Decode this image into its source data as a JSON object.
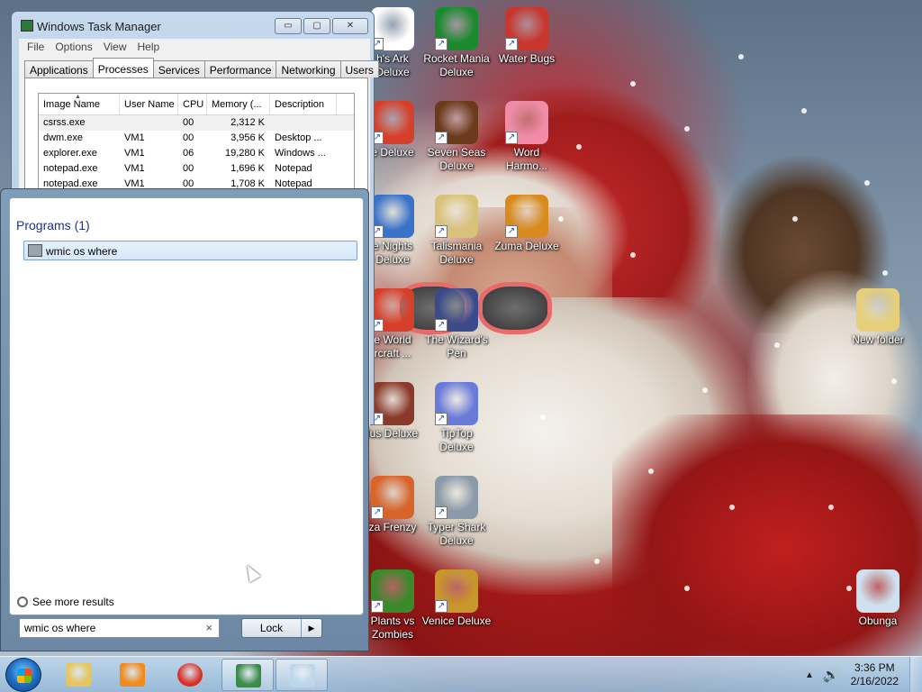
{
  "desktop": {
    "icons": [
      {
        "label": "h's Ark\nDeluxe",
        "color": "#ffffff"
      },
      {
        "label": "Rocket Mania\nDeluxe",
        "color": "#1b8a2e"
      },
      {
        "label": "Water Bugs",
        "color": "#c8362e"
      },
      {
        "label": "e Deluxe",
        "color": "#d6402a"
      },
      {
        "label": "Seven Seas\nDeluxe",
        "color": "#6b3a1a"
      },
      {
        "label": "Word\nHarmo...",
        "color": "#f08ca8"
      },
      {
        "label": "e Nights\nDeluxe",
        "color": "#3a72c9"
      },
      {
        "label": "Talismania\nDeluxe",
        "color": "#d8c27a"
      },
      {
        "label": "Zuma Deluxe",
        "color": "#d88a1c"
      },
      {
        "label": "e World\nrcraft ...",
        "color": "#d6402a"
      },
      {
        "label": "The Wizard's\nPen",
        "color": "#3a4a8a"
      },
      {
        "label": "New folder",
        "color": "#e6cf7a"
      },
      {
        "label": "lus Deluxe",
        "color": "#8a3a2a"
      },
      {
        "label": "TipTop\nDeluxe",
        "color": "#6a7ad8"
      },
      {
        "label": "za Frenzy",
        "color": "#d8642a"
      },
      {
        "label": "Typer Shark\nDeluxe",
        "color": "#8a9aa8"
      },
      {
        "label": "Plants vs\nZombies",
        "color": "#3a8a2a"
      },
      {
        "label": "Venice Deluxe",
        "color": "#c8962a"
      },
      {
        "label": "Obunga",
        "color": "#cfe0ee"
      }
    ]
  },
  "task_manager": {
    "title": "Windows Task Manager",
    "menu": [
      "File",
      "Options",
      "View",
      "Help"
    ],
    "window_buttons": [
      "▭",
      "▢",
      "✕"
    ],
    "tabs": [
      "Applications",
      "Processes",
      "Services",
      "Performance",
      "Networking",
      "Users"
    ],
    "active_tab": "Processes",
    "columns": [
      "Image Name",
      "User Name",
      "CPU",
      "Memory (...",
      "Description"
    ],
    "rows": [
      [
        "csrss.exe",
        "",
        "00",
        "2,312 K",
        ""
      ],
      [
        "dwm.exe",
        "VM1",
        "00",
        "3,956 K",
        "Desktop ..."
      ],
      [
        "explorer.exe",
        "VM1",
        "06",
        "19,280 K",
        "Windows ..."
      ],
      [
        "notepad.exe",
        "VM1",
        "00",
        "1,696 K",
        "Notepad"
      ],
      [
        "notepad.exe",
        "VM1",
        "00",
        "1,708 K",
        "Notepad"
      ]
    ]
  },
  "start_menu": {
    "results_heading": "Programs (1)",
    "result_label": "wmic os where",
    "see_more": "See more results",
    "search_value": "wmic os where",
    "clear_glyph": "×",
    "lock_label": "Lock",
    "lock_arrow": "▶"
  },
  "taskbar": {
    "pinned": [
      {
        "name": "explorer",
        "color": "#e8c45a"
      },
      {
        "name": "media-player",
        "color": "#f08a1a"
      },
      {
        "name": "chrome",
        "color": "#d93025"
      },
      {
        "name": "task-manager",
        "color": "#3c8a4a"
      },
      {
        "name": "notepad",
        "color": "#bcd6ea"
      }
    ],
    "tray_arrow": "▲",
    "volume_glyph": "🔊",
    "time": "3:36 PM",
    "date": "2/16/2022"
  }
}
